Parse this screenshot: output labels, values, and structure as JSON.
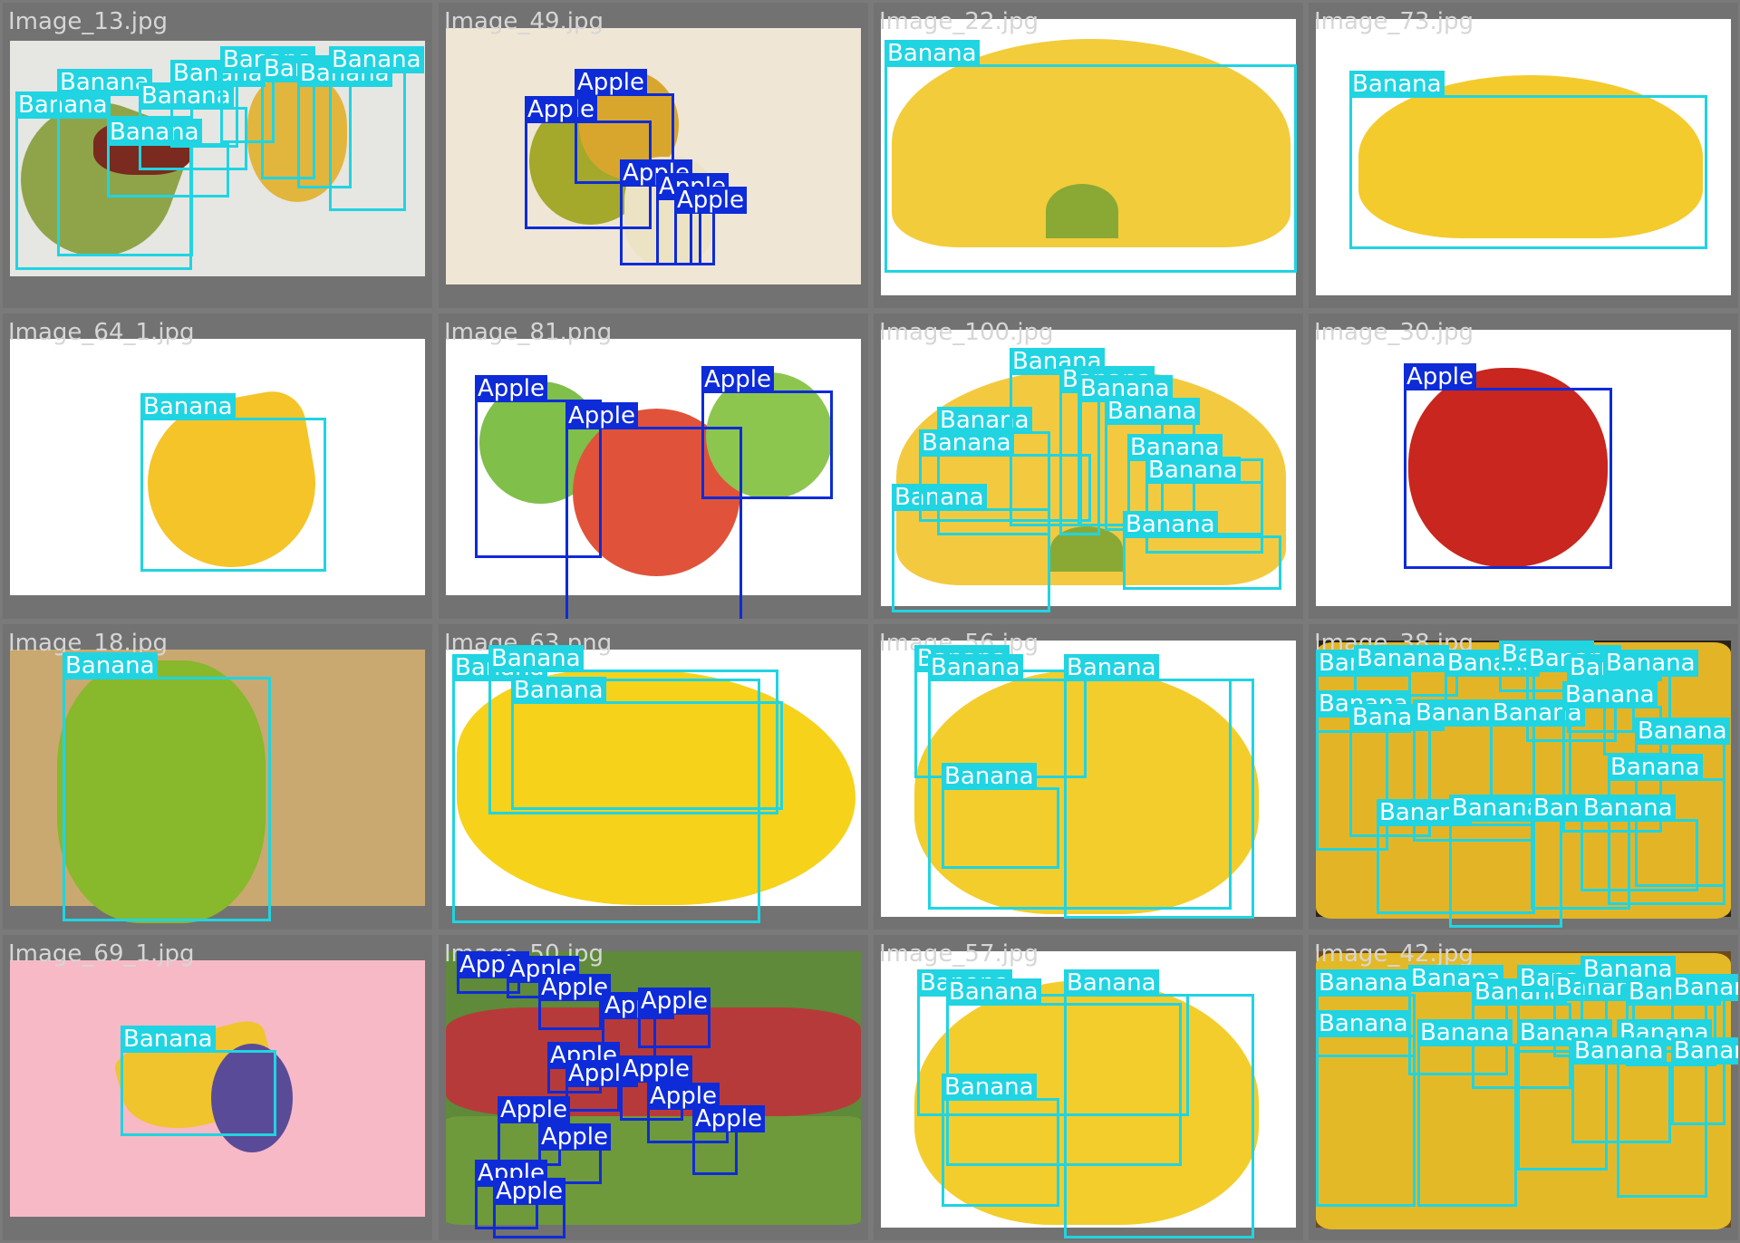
{
  "colors": {
    "banana": "#20d4e2",
    "apple": "#0e2bd8",
    "label_text": "#ffffff",
    "filename_text": "#d6d6d6",
    "tile_gap": "#7a7a7a"
  },
  "labels": {
    "banana": "Banana",
    "apple": "Apple"
  },
  "tiles": [
    {
      "name": "Image_13.jpg",
      "bg": "#e6e6e2",
      "fruit": "mixed"
    },
    {
      "name": "Image_49.jpg",
      "bg": "#efe6d6",
      "fruit": "apple"
    },
    {
      "name": "Image_22.jpg",
      "bg": "#ffffff",
      "fruit": "banana"
    },
    {
      "name": "Image_73.jpg",
      "bg": "#ffffff",
      "fruit": "banana"
    },
    {
      "name": "Image_64_1.jpg",
      "bg": "#ffffff",
      "fruit": "banana"
    },
    {
      "name": "Image_81.png",
      "bg": "#ffffff",
      "fruit": "apple"
    },
    {
      "name": "Image_100.jpg",
      "bg": "#ffffff",
      "fruit": "banana"
    },
    {
      "name": "Image_30.jpg",
      "bg": "#ffffff",
      "fruit": "apple"
    },
    {
      "name": "Image_18.jpg",
      "bg": "#c9a970",
      "fruit": "green-banana"
    },
    {
      "name": "Image_63.png",
      "bg": "#ffffff",
      "fruit": "banana"
    },
    {
      "name": "Image_56.jpg",
      "bg": "#ffffff",
      "fruit": "banana"
    },
    {
      "name": "Image_38.jpg",
      "bg": "#2a2318",
      "fruit": "banana"
    },
    {
      "name": "Image_69_1.jpg",
      "bg": "#f7b9c6",
      "fruit": "banana"
    },
    {
      "name": "Image_50.jpg",
      "bg": "#5e8a3a",
      "fruit": "apple"
    },
    {
      "name": "Image_57.jpg",
      "bg": "#ffffff",
      "fruit": "banana"
    },
    {
      "name": "Image_42.jpg",
      "bg": "#6b4a20",
      "fruit": "banana"
    }
  ]
}
